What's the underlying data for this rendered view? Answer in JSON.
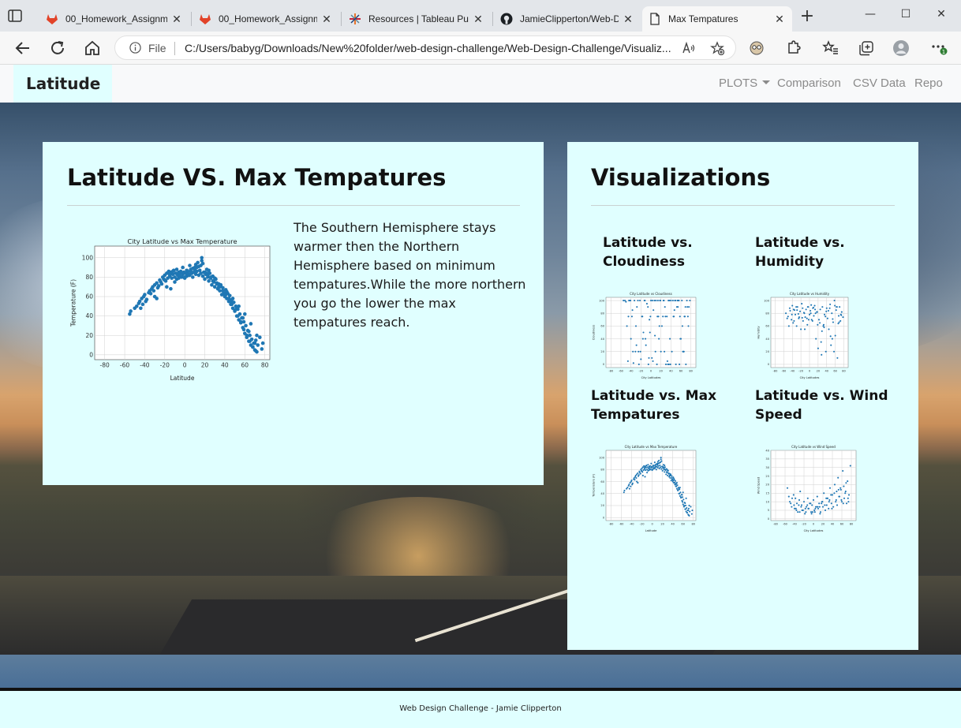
{
  "browser": {
    "tabs": [
      {
        "title": "00_Homework_Assignm",
        "icon": "gitlab-icon"
      },
      {
        "title": "00_Homework_Assignm",
        "icon": "gitlab-icon"
      },
      {
        "title": "Resources | Tableau Pub",
        "icon": "tableau-icon"
      },
      {
        "title": "JamieClipperton/Web-D",
        "icon": "github-icon"
      },
      {
        "title": "Max Tempatures",
        "icon": "page-icon"
      }
    ],
    "address": {
      "scheme_label": "File",
      "url": "C:/Users/babyg/Downloads/New%20folder/web-design-challenge/Web-Design-Challenge/Visualiz..."
    },
    "accent_colors": {
      "gitlab": "#e24329",
      "profile_badge": "#2e7d32"
    }
  },
  "navbar": {
    "brand": "Latitude",
    "links": [
      {
        "label": "PLOTS",
        "dropdown": true
      },
      {
        "label": "Comparison"
      },
      {
        "label": "CSV Data"
      },
      {
        "label": "Repo"
      }
    ]
  },
  "main": {
    "heading": "Latitude VS. Max Tempatures",
    "description": "The Southern Hemisphere stays warmer then the Northern Hemisphere based on minimum tempatures.While the more northern you go the lower the max tempatures reach.",
    "card_background": "#e0ffff"
  },
  "sidebar": {
    "heading": "Visualizations",
    "items": [
      {
        "title": "Latitude vs. Cloudiness"
      },
      {
        "title": "Latitude vs. Humidity"
      },
      {
        "title": "Latitude vs. Max Tempatures"
      },
      {
        "title": "Latitude vs. Wind Speed"
      }
    ]
  },
  "footer": {
    "text": "Web Design Challenge - Jamie Clipperton"
  },
  "chart_data": [
    {
      "type": "scatter",
      "title": "City Latitude vs Max Temperature",
      "xlabel": "Latitude",
      "ylabel": "Temperature (F)",
      "xlim": [
        -90,
        85
      ],
      "ylim": [
        -5,
        112
      ],
      "xticks": [
        -80,
        -60,
        -40,
        -20,
        0,
        20,
        40,
        60,
        80
      ],
      "yticks": [
        0,
        20,
        40,
        60,
        80,
        100
      ],
      "grid": true,
      "color": "#1f77b4",
      "x": [
        -55,
        -54,
        -50,
        -48,
        -46,
        -45,
        -43,
        -41,
        -40,
        -38,
        -36,
        -35,
        -34,
        -33,
        -32,
        -30,
        -28,
        -27,
        -25,
        -24,
        -22,
        -21,
        -20,
        -19,
        -18,
        -17,
        -16,
        -15,
        -14,
        -13,
        -12,
        -11,
        -10,
        -9,
        -8,
        -7,
        -6,
        -5,
        -4,
        -3,
        -2,
        -1,
        0,
        1,
        2,
        3,
        4,
        5,
        6,
        7,
        8,
        9,
        10,
        11,
        12,
        13,
        14,
        15,
        16,
        17,
        18,
        19,
        20,
        21,
        22,
        23,
        24,
        25,
        26,
        27,
        28,
        29,
        30,
        31,
        32,
        33,
        34,
        35,
        36,
        37,
        38,
        39,
        40,
        41,
        42,
        43,
        44,
        45,
        46,
        47,
        48,
        49,
        50,
        51,
        52,
        53,
        54,
        55,
        56,
        57,
        58,
        59,
        60,
        61,
        62,
        63,
        64,
        65,
        66,
        67,
        68,
        69,
        70,
        71,
        72,
        73,
        75,
        77,
        78,
        -44,
        -39,
        -31,
        -26,
        -23,
        -20,
        -15,
        -12,
        -8,
        -5,
        -2,
        2,
        5,
        8,
        11,
        14,
        17,
        20,
        23,
        26,
        29,
        32,
        35,
        38,
        41,
        44,
        47,
        50,
        53,
        56,
        59,
        62,
        65,
        68,
        71,
        -30,
        -18,
        -10,
        0,
        6,
        12,
        18,
        24,
        30,
        36,
        42,
        48,
        54,
        60,
        66,
        72,
        -42,
        -28,
        -14,
        -6,
        4,
        10,
        16,
        22,
        28,
        34,
        40,
        46,
        52,
        58,
        64,
        70
      ],
      "y": [
        42,
        45,
        48,
        50,
        53,
        55,
        58,
        60,
        62,
        57,
        64,
        66,
        63,
        68,
        70,
        72,
        74,
        69,
        77,
        75,
        80,
        78,
        82,
        76,
        84,
        79,
        86,
        81,
        85,
        79,
        83,
        87,
        80,
        84,
        78,
        82,
        85,
        81,
        86,
        80,
        83,
        85,
        79,
        84,
        81,
        86,
        83,
        82,
        88,
        84,
        80,
        85,
        90,
        83,
        86,
        95,
        82,
        87,
        84,
        100,
        81,
        85,
        78,
        83,
        88,
        80,
        76,
        84,
        79,
        72,
        81,
        75,
        70,
        78,
        74,
        68,
        73,
        66,
        71,
        62,
        69,
        64,
        60,
        67,
        58,
        63,
        55,
        61,
        52,
        57,
        48,
        54,
        45,
        50,
        40,
        47,
        36,
        42,
        33,
        38,
        28,
        34,
        22,
        30,
        18,
        25,
        14,
        20,
        10,
        16,
        8,
        12,
        5,
        15,
        3,
        10,
        18,
        6,
        12,
        48,
        55,
        66,
        71,
        73,
        77,
        83,
        86,
        88,
        84,
        90,
        87,
        92,
        89,
        93,
        91,
        97,
        85,
        82,
        80,
        76,
        73,
        70,
        66,
        62,
        58,
        52,
        46,
        40,
        34,
        26,
        20,
        14,
        8,
        4,
        60,
        70,
        75,
        80,
        86,
        90,
        94,
        87,
        79,
        72,
        65,
        58,
        50,
        42,
        32,
        20,
        52,
        58,
        68,
        79,
        82,
        88,
        92,
        84,
        76,
        70,
        62,
        55,
        48,
        38,
        24,
        12
      ]
    },
    {
      "type": "scatter",
      "title": "City Latitude vs Cloudiness",
      "xlabel": "City Latitudes",
      "ylabel": "Cloudiness",
      "xlim": [
        -90,
        90
      ],
      "ylim": [
        -5,
        105
      ],
      "xticks": [
        -80,
        -60,
        -40,
        -20,
        0,
        20,
        40,
        60,
        80
      ],
      "yticks": [
        0,
        20,
        40,
        60,
        80,
        100
      ],
      "grid": true,
      "color": "#1f77b4",
      "x": [
        -55,
        -50,
        -46,
        -42,
        -40,
        -38,
        -35,
        -33,
        -30,
        -28,
        -25,
        -22,
        -20,
        -18,
        -15,
        -12,
        -10,
        -8,
        -5,
        -3,
        0,
        2,
        5,
        8,
        10,
        12,
        15,
        18,
        20,
        22,
        25,
        28,
        30,
        32,
        35,
        38,
        40,
        42,
        45,
        48,
        50,
        52,
        55,
        58,
        60,
        62,
        65,
        68,
        70,
        72,
        75,
        78,
        -45,
        -36,
        -26,
        -16,
        -6,
        4,
        14,
        24,
        34,
        44,
        54,
        64,
        74,
        -48,
        -37,
        -24,
        -13,
        -2,
        9,
        19,
        29,
        39,
        49,
        59,
        69,
        -41,
        -29,
        -17,
        -4,
        7,
        17,
        27,
        37,
        47,
        57,
        67,
        -52,
        -31,
        -11,
        3,
        13,
        33,
        53,
        63,
        73,
        -44,
        -21,
        -1,
        16,
        26,
        36,
        46,
        56,
        66,
        76
      ],
      "y": [
        100,
        98,
        5,
        100,
        40,
        75,
        2,
        100,
        60,
        90,
        20,
        100,
        8,
        75,
        50,
        100,
        30,
        95,
        0,
        70,
        100,
        10,
        85,
        45,
        100,
        0,
        75,
        100,
        20,
        60,
        100,
        90,
        0,
        75,
        100,
        40,
        100,
        20,
        75,
        100,
        0,
        90,
        100,
        75,
        40,
        100,
        20,
        75,
        0,
        100,
        60,
        100,
        75,
        20,
        100,
        40,
        90,
        5,
        100,
        75,
        0,
        100,
        90,
        20,
        75,
        60,
        85,
        0,
        100,
        50,
        20,
        100,
        75,
        0,
        100,
        40,
        90,
        100,
        30,
        75,
        10,
        100,
        60,
        20,
        100,
        85,
        0,
        75,
        100,
        20,
        40,
        100,
        75,
        5,
        100,
        60,
        90,
        100,
        20,
        75,
        40,
        100,
        0,
        75,
        100,
        20,
        90,
        50
      ],
      "note": "none"
    },
    {
      "type": "scatter",
      "title": "City Latitude vs Humidity",
      "xlabel": "City Latitudes",
      "ylabel": "Humidity",
      "xlim": [
        -90,
        90
      ],
      "ylim": [
        -5,
        105
      ],
      "xticks": [
        -80,
        -60,
        -40,
        -20,
        0,
        20,
        40,
        60,
        80
      ],
      "yticks": [
        0,
        20,
        40,
        60,
        80,
        100
      ],
      "grid": true,
      "color": "#1f77b4",
      "x": [
        -55,
        -50,
        -46,
        -42,
        -40,
        -38,
        -35,
        -33,
        -30,
        -28,
        -25,
        -22,
        -20,
        -18,
        -15,
        -12,
        -10,
        -8,
        -5,
        -3,
        0,
        2,
        5,
        8,
        10,
        12,
        15,
        18,
        20,
        22,
        25,
        28,
        30,
        32,
        35,
        38,
        40,
        42,
        45,
        48,
        50,
        52,
        55,
        58,
        60,
        62,
        65,
        68,
        70,
        72,
        75,
        78,
        -45,
        -36,
        -26,
        -16,
        -6,
        4,
        14,
        24,
        34,
        44,
        54,
        64,
        74,
        -48,
        -37,
        -24,
        -13,
        -2,
        9,
        19,
        29,
        39,
        49,
        59,
        69,
        -41,
        -29,
        -17,
        -4,
        7,
        17,
        27,
        37,
        47,
        57,
        67,
        -52,
        -31,
        -11,
        3,
        13,
        33,
        53,
        63,
        73
      ],
      "y": [
        80,
        75,
        88,
        70,
        92,
        65,
        85,
        78,
        60,
        90,
        72,
        83,
        55,
        95,
        68,
        80,
        74,
        86,
        62,
        90,
        78,
        84,
        70,
        88,
        76,
        92,
        40,
        82,
        25,
        70,
        86,
        15,
        90,
        60,
        78,
        20,
        88,
        72,
        55,
        94,
        30,
        80,
        66,
        100,
        45,
        85,
        10,
        76,
        90,
        68,
        82,
        74,
        84,
        68,
        79,
        88,
        72,
        93,
        80,
        65,
        58,
        84,
        71,
        90,
        77,
        60,
        86,
        74,
        81,
        70,
        89,
        62,
        52,
        83,
        44,
        92,
        66,
        78,
        85,
        73,
        90,
        68,
        82,
        35,
        75,
        88,
        20,
        64,
        72,
        90,
        55,
        80,
        86,
        62,
        40,
        90,
        78,
        70
      ],
      "note": "none"
    },
    {
      "type": "scatter",
      "title": "City Latitude vs Wind Speed",
      "xlabel": "City Latitudes",
      "ylabel": "Wind Speed",
      "xlim": [
        -90,
        90
      ],
      "ylim": [
        -1,
        40
      ],
      "xticks": [
        -80,
        -60,
        -40,
        -20,
        0,
        20,
        40,
        60,
        80
      ],
      "yticks": [
        0,
        5,
        10,
        15,
        20,
        25,
        30,
        35,
        40
      ],
      "grid": true,
      "color": "#1f77b4",
      "x": [
        -55,
        -50,
        -46,
        -42,
        -40,
        -38,
        -35,
        -33,
        -30,
        -28,
        -25,
        -22,
        -20,
        -18,
        -15,
        -12,
        -10,
        -8,
        -5,
        -3,
        0,
        2,
        5,
        8,
        10,
        12,
        15,
        18,
        20,
        22,
        25,
        28,
        30,
        32,
        35,
        38,
        40,
        42,
        45,
        48,
        50,
        52,
        55,
        58,
        60,
        62,
        65,
        68,
        70,
        72,
        75,
        78,
        -45,
        -36,
        -26,
        -16,
        -6,
        4,
        14,
        24,
        34,
        44,
        54,
        64,
        74,
        -48,
        -37,
        -24,
        -13,
        -2,
        9,
        19,
        29,
        39,
        49,
        59,
        69,
        -41,
        -29,
        -17,
        -4,
        7,
        17,
        27,
        37,
        47,
        57,
        67,
        -52,
        -31,
        -11,
        3,
        13,
        33,
        53,
        63,
        73
      ],
      "y": [
        18,
        10,
        7,
        14,
        6,
        12,
        9,
        4,
        11,
        16,
        8,
        5,
        10,
        3,
        7,
        12,
        6,
        9,
        4,
        8,
        11,
        5,
        7,
        13,
        6,
        9,
        4,
        10,
        7,
        15,
        5,
        8,
        12,
        6,
        18,
        9,
        14,
        7,
        20,
        11,
        8,
        24,
        13,
        17,
        10,
        28,
        12,
        16,
        9,
        22,
        14,
        31,
        12,
        5,
        7,
        4,
        9,
        6,
        3,
        8,
        11,
        15,
        13,
        19,
        10,
        9,
        6,
        5,
        8,
        4,
        7,
        10,
        12,
        6,
        16,
        11,
        21,
        8,
        4,
        6,
        3,
        7,
        9,
        12,
        14,
        10,
        18,
        15,
        13,
        8,
        6,
        4,
        7,
        10,
        17,
        9,
        12
      ],
      "note": "none"
    }
  ]
}
